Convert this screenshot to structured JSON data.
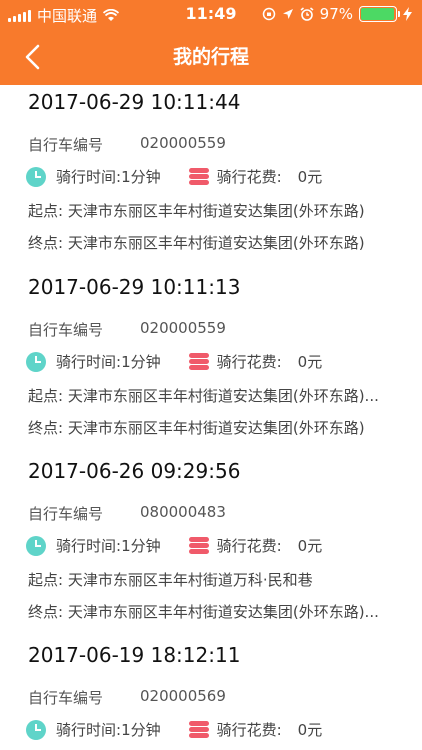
{
  "status_bar": {
    "carrier": "中国联通",
    "time": "11:49",
    "battery_percent": "97%",
    "battery_level": 0.97
  },
  "nav": {
    "title": "我的行程"
  },
  "labels": {
    "bike_no": "自行车编号",
    "ride_time": "骑行时间:",
    "ride_fee": "骑行花费:",
    "start": "起点:",
    "end": "终点:"
  },
  "trips": [
    {
      "datetime": "2017-06-29 10:11:44",
      "bike_no": "020000559",
      "duration": "1分钟",
      "fee": "0元",
      "start": "天津市东丽区丰年村街道安达集团(外环东路)",
      "end": "天津市东丽区丰年村街道安达集团(外环东路)"
    },
    {
      "datetime": "2017-06-29 10:11:13",
      "bike_no": "020000559",
      "duration": "1分钟",
      "fee": "0元",
      "start": "天津市东丽区丰年村街道安达集团(外环东路)...",
      "end": "天津市东丽区丰年村街道安达集团(外环东路)"
    },
    {
      "datetime": "2017-06-26 09:29:56",
      "bike_no": "080000483",
      "duration": "1分钟",
      "fee": "0元",
      "start": "天津市东丽区丰年村街道万科·民和巷",
      "end": "天津市东丽区丰年村街道安达集团(外环东路)..."
    },
    {
      "datetime": "2017-06-19 18:12:11",
      "bike_no": "020000569",
      "duration": "1分钟",
      "fee": "0元"
    }
  ]
}
